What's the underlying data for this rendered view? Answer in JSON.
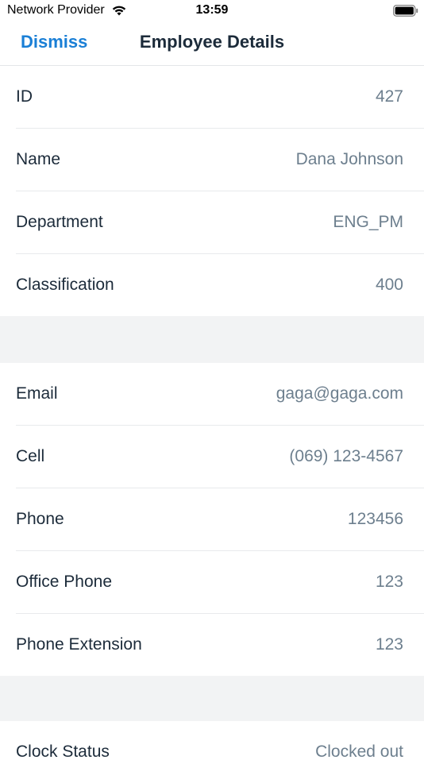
{
  "status_bar": {
    "carrier": "Network Provider",
    "time": "13:59",
    "wifi_icon": "wifi-icon",
    "battery_icon": "battery-icon"
  },
  "nav": {
    "dismiss_label": "Dismiss",
    "title": "Employee Details",
    "accent_color": "#1a7fd6"
  },
  "sections": [
    {
      "rows": [
        {
          "label": "ID",
          "value": "427"
        },
        {
          "label": "Name",
          "value": "Dana Johnson"
        },
        {
          "label": "Department",
          "value": "ENG_PM"
        },
        {
          "label": "Classification",
          "value": "400"
        }
      ]
    },
    {
      "rows": [
        {
          "label": "Email",
          "value": "gaga@gaga.com"
        },
        {
          "label": "Cell",
          "value": "(069) 123-4567"
        },
        {
          "label": "Phone",
          "value": "123456"
        },
        {
          "label": "Office Phone",
          "value": "123"
        },
        {
          "label": "Phone Extension",
          "value": "123"
        }
      ]
    },
    {
      "rows": [
        {
          "label": "Clock Status",
          "value": "Clocked out"
        }
      ]
    }
  ]
}
